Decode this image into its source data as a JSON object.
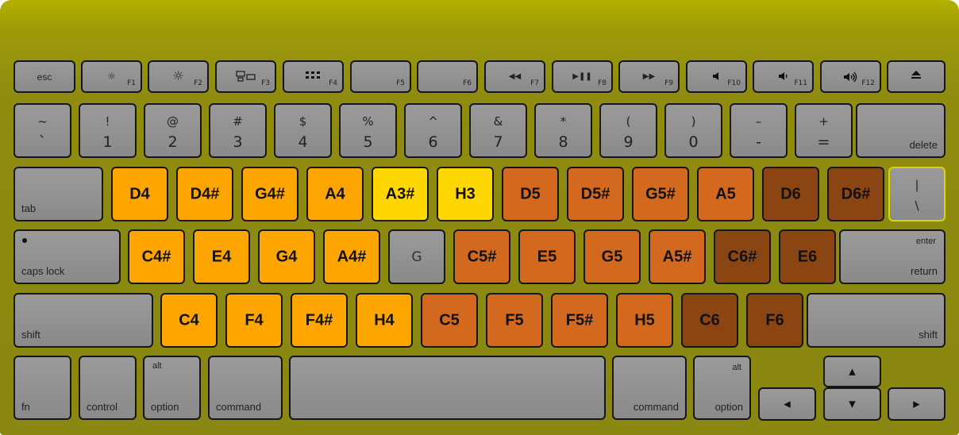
{
  "function_row": [
    {
      "id": "esc",
      "label": "esc",
      "icon": "escape-key",
      "fn": ""
    },
    {
      "id": "f1",
      "label": "",
      "icon": "brightness-down-icon",
      "fn": "F1"
    },
    {
      "id": "f2",
      "label": "",
      "icon": "brightness-up-icon",
      "fn": "F2"
    },
    {
      "id": "f3",
      "label": "",
      "icon": "mission-control-icon",
      "fn": "F3"
    },
    {
      "id": "f4",
      "label": "",
      "icon": "launchpad-icon",
      "fn": "F4"
    },
    {
      "id": "f5",
      "label": "",
      "icon": "",
      "fn": "F5"
    },
    {
      "id": "f6",
      "label": "",
      "icon": "",
      "fn": "F6"
    },
    {
      "id": "f7",
      "label": "",
      "icon": "rewind-icon",
      "fn": "F7"
    },
    {
      "id": "f8",
      "label": "",
      "icon": "play-pause-icon",
      "fn": "F8"
    },
    {
      "id": "f9",
      "label": "",
      "icon": "fast-forward-icon",
      "fn": "F9"
    },
    {
      "id": "f10",
      "label": "",
      "icon": "mute-icon",
      "fn": "F10"
    },
    {
      "id": "f11",
      "label": "",
      "icon": "volume-down-icon",
      "fn": "F11"
    },
    {
      "id": "f12",
      "label": "",
      "icon": "volume-up-icon",
      "fn": "F12"
    },
    {
      "id": "eject",
      "label": "",
      "icon": "eject-icon",
      "fn": ""
    }
  ],
  "number_row": [
    {
      "top": "~",
      "bottom": "`"
    },
    {
      "top": "!",
      "bottom": "1"
    },
    {
      "top": "@",
      "bottom": "2"
    },
    {
      "top": "#",
      "bottom": "3"
    },
    {
      "top": "$",
      "bottom": "4"
    },
    {
      "top": "%",
      "bottom": "5"
    },
    {
      "top": "^",
      "bottom": "6"
    },
    {
      "top": "&",
      "bottom": "7"
    },
    {
      "top": "*",
      "bottom": "8"
    },
    {
      "top": "(",
      "bottom": "9"
    },
    {
      "top": ")",
      "bottom": "0"
    },
    {
      "top": "–",
      "bottom": "-"
    },
    {
      "top": "+",
      "bottom": "="
    }
  ],
  "number_row_delete": "delete",
  "tab_label": "tab",
  "row_q_notes": [
    "D4",
    "D4#",
    "G4#",
    "A4",
    "A3#",
    "H3",
    "D5",
    "D5#",
    "G5#",
    "A5",
    "D6",
    "D6#"
  ],
  "backslash": {
    "top": "|",
    "bottom": "\\"
  },
  "caps_label": "caps lock",
  "row_a_notes": [
    "C4#",
    "E4",
    "G4",
    "A4#",
    "G",
    "C5#",
    "E5",
    "G5",
    "A5#",
    "C6#",
    "E6"
  ],
  "return": {
    "top": "enter",
    "bottom": "return"
  },
  "shift_label": "shift",
  "row_z_notes": [
    "C4",
    "F4",
    "F4#",
    "H4",
    "C5",
    "F5",
    "F5#",
    "H5",
    "C6",
    "F6"
  ],
  "bottom_row": {
    "fn": "fn",
    "control": "control",
    "alt": "alt",
    "option": "option",
    "command": "command"
  },
  "colors": {
    "board": "#9c9a0a",
    "key_gray": "#8f8f8f",
    "note_orange": "#ffa500",
    "note_yellow": "#ffd700",
    "note_dark_orange": "#d2691e",
    "note_brown": "#8b4513"
  }
}
